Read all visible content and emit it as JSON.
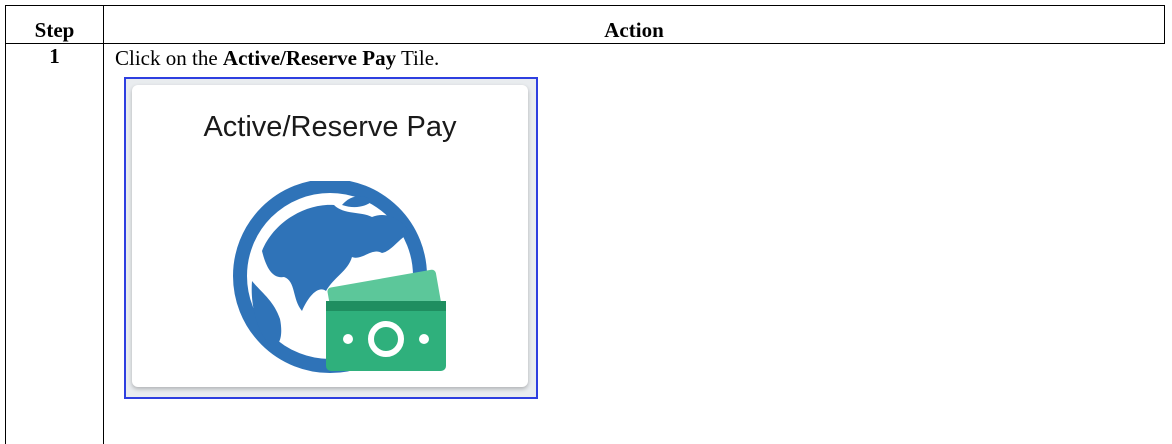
{
  "table": {
    "headers": {
      "step": "Step",
      "action": "Action"
    },
    "rows": [
      {
        "step": "1",
        "action_prefix": "Click on the ",
        "action_bold": "Active/Reserve Pay",
        "action_suffix": " Tile."
      }
    ]
  },
  "tile": {
    "title": "Active/Reserve Pay",
    "icon": "globe-with-money-icon",
    "colors": {
      "globe": "#2f73b8",
      "money": "#2fb07c",
      "money_dark": "#1f8e60",
      "frame_border": "#2e3fe0"
    }
  }
}
